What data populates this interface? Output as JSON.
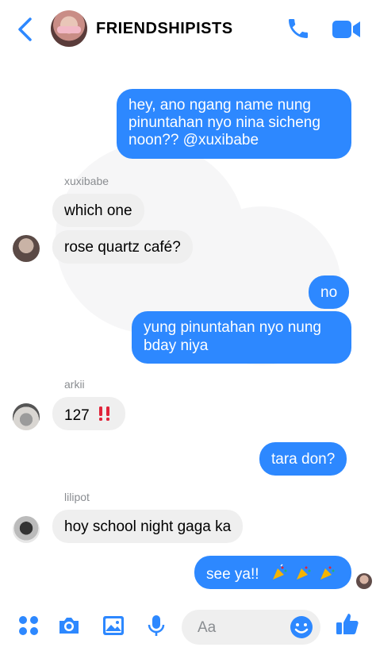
{
  "header": {
    "title": "FRIENDSHIPISTS",
    "accent": "#2d88ff"
  },
  "messages": [
    {
      "side": "out",
      "lines": [
        "hey, ano ngang name nung",
        "pinuntahan nyo nina sicheng",
        "noon?? @xuxibabe"
      ]
    },
    {
      "side": "in",
      "sender": "xuxibabe",
      "text": "which one"
    },
    {
      "side": "in",
      "text": "rose quartz café?"
    },
    {
      "side": "out",
      "text": "no"
    },
    {
      "side": "out",
      "lines": [
        "yung pinuntahan nyo nung",
        "bday niya"
      ]
    },
    {
      "side": "in",
      "sender": "arkii",
      "text": "127",
      "emoji": "double-exclamation-icon"
    },
    {
      "side": "out",
      "text": "tara don?"
    },
    {
      "side": "in",
      "sender": "lilipot",
      "text": "hoy school night gaga ka"
    },
    {
      "side": "out",
      "text": "see ya!!",
      "emoji": "party-popper-icon x3"
    }
  ],
  "composer": {
    "placeholder": "Aa",
    "icons": [
      "apps-icon",
      "camera-icon",
      "gallery-icon",
      "microphone-icon",
      "emoji-icon",
      "thumbs-up-icon"
    ]
  }
}
